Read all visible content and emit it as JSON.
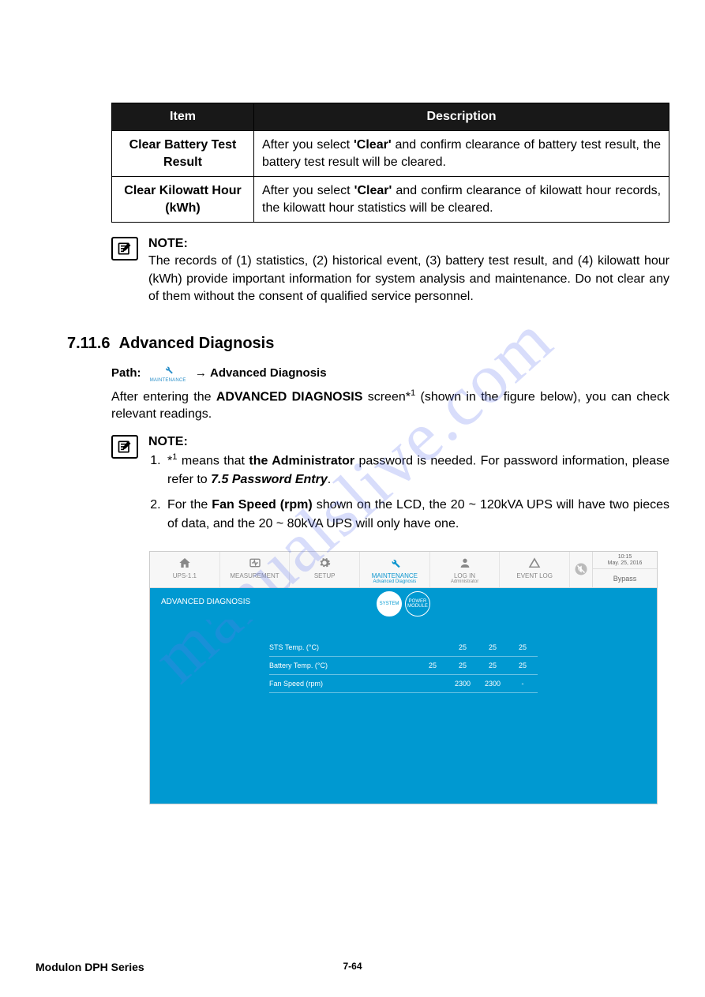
{
  "table": {
    "headers": [
      "Item",
      "Description"
    ],
    "rows": [
      {
        "item": "Clear Battery Test Result",
        "desc_pre": "After you select ",
        "desc_bold": "'Clear'",
        "desc_post": " and confirm clearance of battery test result, the battery test result will be cleared."
      },
      {
        "item": "Clear Kilowatt Hour (kWh)",
        "desc_pre": "After you select ",
        "desc_bold": "'Clear'",
        "desc_post": " and confirm clearance of kilowatt hour records, the kilowatt hour statistics will be cleared."
      }
    ]
  },
  "note1": {
    "title": "NOTE:",
    "text": "The records of (1) statistics, (2) historical event, (3) battery test result, and (4) kilowatt hour (kWh) provide important information for system analysis and maintenance. Do not clear any of them without the consent of qualified service personnel."
  },
  "section": {
    "number": "7.11.6",
    "title": "Advanced Diagnosis"
  },
  "path": {
    "label": "Path:",
    "icon_text": "MAINTENANCE",
    "arrow": "→",
    "dest": "Advanced Diagnosis"
  },
  "intro": {
    "pre": "After entering the ",
    "bold": "ADVANCED DIAGNOSIS",
    "post1": " screen*",
    "sup": "1",
    "post2": " (shown in the figure below), you can check relevant readings."
  },
  "note2": {
    "title": "NOTE:",
    "items": [
      {
        "pre": "*",
        "sup": "1",
        "mid1": " means that ",
        "bold1": "the Administrator",
        "mid2": " password is needed. For password information, please refer to ",
        "bolditalic": "7.5 Password Entry",
        "post": "."
      },
      {
        "pre": "For the ",
        "bold1": "Fan Speed (rpm)",
        "post": " shown on the LCD, the 20 ~ 120kVA UPS will have two pieces of data, and the 20 ~ 80kVA UPS will only have one."
      }
    ]
  },
  "screenshot": {
    "toolbar": [
      {
        "label": "UPS-1.1",
        "sub": ""
      },
      {
        "label": "MEASUREMENT",
        "sub": ""
      },
      {
        "label": "SETUP",
        "sub": ""
      },
      {
        "label": "MAINTENANCE",
        "sub": "Advanced Diagnosis",
        "active": true
      },
      {
        "label": "LOG IN",
        "sub": "Administrator"
      },
      {
        "label": "EVENT LOG",
        "sub": ""
      }
    ],
    "clock": {
      "time": "10:15",
      "date": "May. 25, 2016"
    },
    "status": "Bypass",
    "subtitle": "ADVANCED DIAGNOSIS",
    "tabs": [
      "SYSTEM",
      "POWER MODULE"
    ],
    "rows": [
      {
        "label": "STS Temp. (°C)",
        "values": [
          "",
          "25",
          "25",
          "25"
        ]
      },
      {
        "label": "Battery Temp. (°C)",
        "values": [
          "25",
          "25",
          "25",
          "25"
        ]
      },
      {
        "label": "Fan Speed (rpm)",
        "values": [
          "",
          "2300",
          "2300",
          "-"
        ]
      }
    ]
  },
  "footer": {
    "series": "Modulon DPH Series",
    "page": "7-64"
  },
  "watermark": "manualslive.com"
}
